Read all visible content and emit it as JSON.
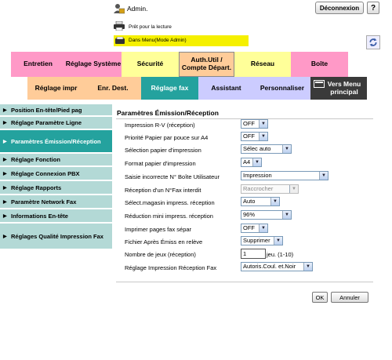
{
  "header": {
    "admin_label": "Admin.",
    "logout_label": "Déconnexion",
    "help_label": "?",
    "status": "Prêt pour la lecture",
    "mode": "Dans Menu(Mode Admin)"
  },
  "tabs_row1": [
    {
      "label": "Entretien",
      "color": "#ff99c7"
    },
    {
      "label": "Réglage Système",
      "color": "#ff99c7"
    },
    {
      "label": "Sécurité",
      "color": "#ffff99"
    },
    {
      "label": "Auth.Util / Compte Départ.",
      "color": "#ffcc99"
    },
    {
      "label": "Réseau",
      "color": "#ffff99"
    },
    {
      "label": "Boîte",
      "color": "#ff99c7"
    }
  ],
  "tabs_row2": [
    {
      "label": "Réglage impr",
      "color": "#ffcc99"
    },
    {
      "label": "Enr. Dest.",
      "color": "#ffcc99"
    },
    {
      "label": "Réglage fax",
      "color": "#24a29e"
    },
    {
      "label": "Assistant",
      "color": "#ccccff"
    },
    {
      "label": "Personnaliser",
      "color": "#ccccff"
    },
    {
      "label": "Vers Menu principal",
      "color": "#3a3a3a"
    }
  ],
  "sidebar": [
    {
      "label": "Position En-tête/Pied pag"
    },
    {
      "label": "Réglage Paramètre Ligne"
    },
    {
      "label": "Paramètres Émission/Réception"
    },
    {
      "label": "Réglage Fonction"
    },
    {
      "label": "Réglage Connexion PBX"
    },
    {
      "label": "Réglage Rapports"
    },
    {
      "label": "Paramètre Network Fax"
    },
    {
      "label": "Informations En-tête"
    },
    {
      "label": "Réglages Qualité Impression Fax"
    }
  ],
  "main": {
    "title": "Paramètres Émission/Réception",
    "fields": [
      {
        "label": "Impression R-V (réception)",
        "value": "OFF"
      },
      {
        "label": "Priorité Papier par pouce sur A4",
        "value": "OFF"
      },
      {
        "label": "Sélection papier d'impression",
        "value": "Sélec auto"
      },
      {
        "label": "Format papier d'impression",
        "value": "A4"
      },
      {
        "label": "Saisie incorrecte N° Boîte Utilisateur",
        "value": "Impression"
      },
      {
        "label": "Réception d'un N°Fax interdit",
        "value": "Raccrocher"
      },
      {
        "label": "Sélect.magasin impress. réception",
        "value": "Auto"
      },
      {
        "label": "Réduction mini impress. réception",
        "value": "96%"
      },
      {
        "label": "Imprimer pages fax sépar",
        "value": "OFF"
      },
      {
        "label": "Fichier Après Émiss en relève",
        "value": "Supprimer"
      },
      {
        "label": "Nombre de jeux (réception)",
        "value": "1",
        "suffix": "jeu. (1-10)"
      },
      {
        "label": "Réglage Impression Réception Fax",
        "value": "Autoris.Coul. et.Noir"
      }
    ],
    "ok_label": "OK",
    "cancel_label": "Annuler"
  }
}
